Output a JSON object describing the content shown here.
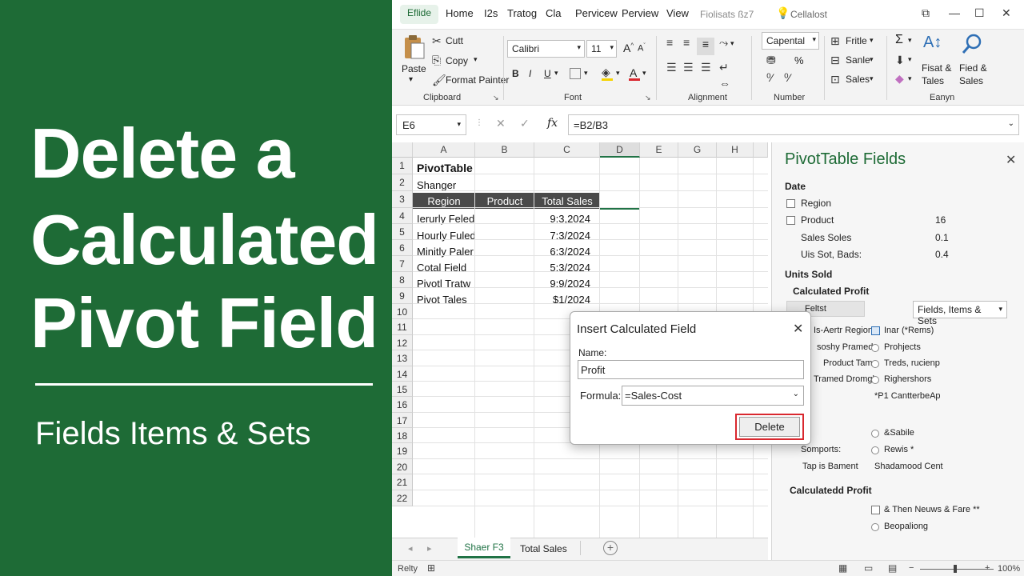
{
  "banner": {
    "title_lines": [
      "Delete a",
      "Calculated",
      "Pivot Field"
    ],
    "subtitle": "Fields Items & Sets"
  },
  "tabs": {
    "file": "Eflide",
    "items": [
      "Home",
      "I2s",
      "Tratog",
      "Cla",
      "Pervicew",
      "Perview",
      "View"
    ],
    "extra": "Fiolisats ßz7",
    "search": "Cellalost"
  },
  "ribbon": {
    "clipboard": {
      "paste": "Paste",
      "cut": "Cutt",
      "copy": "Copy",
      "format_painter": "Format Painter",
      "label": "Clipboard"
    },
    "font": {
      "name": "Calibri",
      "size": "11",
      "grow": "A",
      "shrink": "A",
      "bold": "B",
      "italic": "I",
      "underline": "U",
      "label": "Font"
    },
    "alignment": {
      "label": "Alignment"
    },
    "number": {
      "format": "Capental",
      "percent": "%",
      "label": "Number"
    },
    "cells": {
      "item1": "Fritle",
      "item2": "Sanle",
      "item3": "Sales"
    },
    "editing": {
      "sigma": "Σ",
      "fiat": "Fisat &",
      "fiat2": "Tales",
      "find": "Fied &",
      "find2": "Sales",
      "label": "Eanyn"
    }
  },
  "formula_bar": {
    "name_box": "E6",
    "fx": "fx",
    "formula": "=B2/B3"
  },
  "sheet": {
    "columns": [
      "A",
      "B",
      "C",
      "D",
      "E",
      "G",
      "H"
    ],
    "rows": [
      "1",
      "2",
      "3",
      "4",
      "5",
      "6",
      "7",
      "8",
      "9",
      "10",
      "11",
      "12",
      "13",
      "14",
      "15",
      "16",
      "17",
      "18",
      "19",
      "20",
      "21",
      "22"
    ],
    "a1": "PivotTable",
    "a2": "Shanger",
    "headers": [
      "Region",
      "Product",
      "Total Sales"
    ],
    "data": [
      {
        "a": "Ierurly Feled",
        "c": "9:3,2024"
      },
      {
        "a": "Hourly Fuled",
        "c": "7:3/2024"
      },
      {
        "a": "Minitly Paler",
        "c": "6:3/2024"
      },
      {
        "a": "Cotal Field",
        "c": "5:3/2024"
      },
      {
        "a": "Pivotl Tratw",
        "c": "9:9/2024"
      },
      {
        "a": "Pivot Tales",
        "c": "$1/2024"
      }
    ],
    "tabs": [
      "Shaer F3",
      "Total Sales"
    ],
    "add_sheet": "+"
  },
  "status": {
    "ready": "Relty",
    "zoom": "100%"
  },
  "pane": {
    "title": "PivotTable Fields",
    "section_date": "Date",
    "fields": [
      {
        "label": "Region",
        "value": ""
      },
      {
        "label": "Product",
        "value": "16"
      },
      {
        "label": "Sales Soles",
        "value": "0.1"
      },
      {
        "label": "Uis Sot, Bads:",
        "value": "0.4"
      }
    ],
    "units_sold": "Units Sold",
    "calc_profit": "Calculated Profit",
    "btn_left": "Feltst",
    "btn_right": "Fields, Items & Sets",
    "list_left": [
      "Is-Aertr Region",
      "soshy Pramed",
      "Product Tame",
      "Tramed Dromgh"
    ],
    "list_right": [
      "Inar (*Rems)",
      "Prohjects",
      "Treds, rucienp",
      "Righershors",
      "*P1 CantterbeAp"
    ],
    "list2_right": [
      "&Sabile",
      "Rewis *",
      "Shadamood Cent"
    ],
    "list2_left": [
      "Somports:",
      "Tap is Bament"
    ],
    "calc_profit2": "Calculatedd Profit",
    "list3": [
      "& Then Neuws & Fare **",
      "Beopaliong"
    ]
  },
  "dialog": {
    "title": "Insert Calculated Field",
    "name_label": "Name:",
    "name_value": "Profit",
    "formula_label": "Formula:",
    "formula_value": "=Sales-Cost",
    "delete": "Delete"
  },
  "colors": {
    "green": "#1e6b36",
    "accent_red": "#d9282f",
    "excel_green": "#217346"
  }
}
